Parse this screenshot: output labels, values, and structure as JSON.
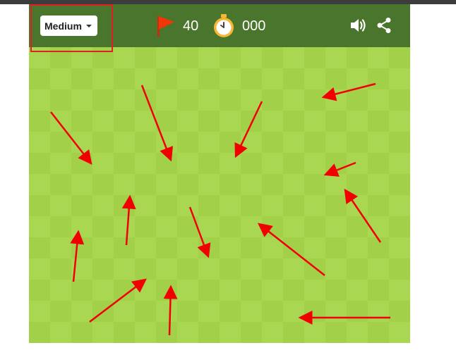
{
  "header": {
    "difficulty": "Medium",
    "flags": "40",
    "timer": "000"
  },
  "board": {
    "cols": 18,
    "rows": 14,
    "color_light": "#aad751",
    "color_dark": "#a2d149"
  },
  "colors": {
    "header_bg": "#4a752c",
    "accent": "#e02020",
    "flag": "#f23607",
    "stopwatch": "#f7b731"
  },
  "icons": {
    "flag": "flag-icon",
    "timer": "stopwatch-icon",
    "sound": "speaker-icon",
    "share": "share-icon"
  }
}
